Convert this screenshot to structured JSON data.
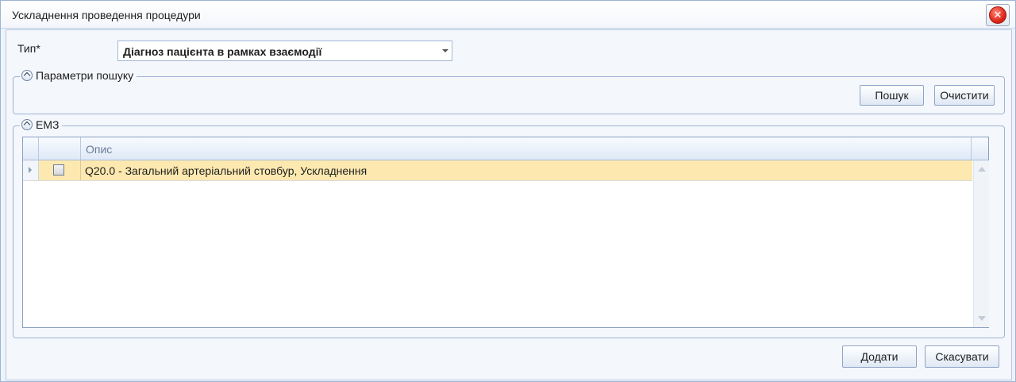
{
  "window": {
    "title": "Ускладнення проведення процедури",
    "close_symbol": "✕"
  },
  "form": {
    "type_label": "Тип*",
    "type_value": "Діагноз пацієнта в рамках взаємодії"
  },
  "search_group": {
    "legend": "Параметри пошуку",
    "search_button": "Пошук",
    "clear_button": "Очистити"
  },
  "emz_group": {
    "legend": "ЕМЗ",
    "grid": {
      "columns": [
        "Опис"
      ],
      "rows": [
        {
          "checked": false,
          "description": "Q20.0 - Загальний артеріальний стовбур, Ускладнення"
        }
      ]
    }
  },
  "footer": {
    "add_button": "Додати",
    "cancel_button": "Скасувати"
  },
  "icons": {
    "close": "close-icon",
    "collapse": "collapse-icon",
    "dropdown": "chevron-down-icon"
  },
  "colors": {
    "selected_row": "#fde9b0",
    "close_red": "#e0261a",
    "border_blue": "#9fb4d3"
  }
}
